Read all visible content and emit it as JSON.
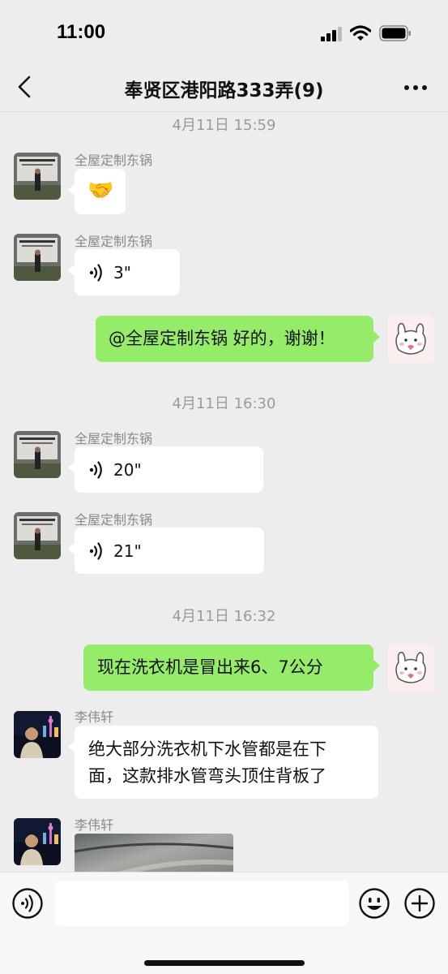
{
  "status_bar": {
    "time": "11:00"
  },
  "nav": {
    "title": "奉贤区港阳路333弄(9)"
  },
  "messages": {
    "ts1": "4月11日 15:59",
    "m1": {
      "sender": "全屋定制东锅",
      "emoji": "🤝"
    },
    "m2": {
      "sender": "全屋定制东锅",
      "duration": "3\""
    },
    "m3": {
      "text": "@全屋定制东锅 好的，谢谢！"
    },
    "ts2": "4月11日 16:30",
    "m4": {
      "sender": "全屋定制东锅",
      "duration": "20\""
    },
    "m5": {
      "sender": "全屋定制东锅",
      "duration": "21\""
    },
    "ts3": "4月11日 16:32",
    "m6": {
      "text": "现在洗衣机是冒出来6、7公分"
    },
    "m7": {
      "sender": "李伟轩",
      "line1": "绝大部分洗衣机下水管都是在下",
      "line2": "面，这款排水管弯头顶住背板了"
    },
    "m8": {
      "sender": "李伟轩"
    }
  },
  "input_bar": {
    "value": ""
  },
  "icons": {
    "back": "chevron-left-icon",
    "more": "more-dots-icon",
    "voice": "voice-wave-icon",
    "emoji": "smiley-icon",
    "plus": "plus-circle-icon"
  },
  "colors": {
    "background": "#ededed",
    "outgoing_bubble": "#95ec69",
    "incoming_bubble": "#ffffff"
  }
}
